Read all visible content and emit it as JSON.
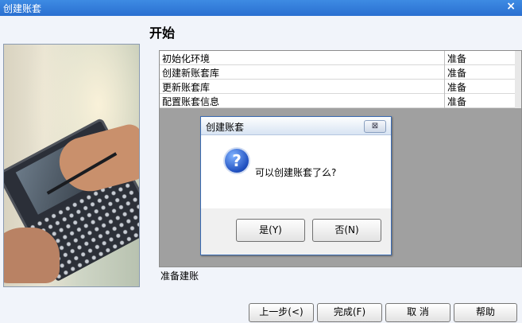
{
  "window": {
    "title": "创建账套",
    "close": "×"
  },
  "heading": "开始",
  "tasks": [
    {
      "name": "初始化环境",
      "status": "准备"
    },
    {
      "name": "创建新账套库",
      "status": "准备"
    },
    {
      "name": "更新账套库",
      "status": "准备"
    },
    {
      "name": "配置账套信息",
      "status": "准备"
    }
  ],
  "status_text": "准备建账",
  "dialog": {
    "title": "创建账套",
    "close": "⊠",
    "icon": "question-icon",
    "icon_glyph": "?",
    "message": "可以创建账套了么?",
    "yes": "是(Y)",
    "no": "否(N)"
  },
  "buttons": {
    "prev": "上一步(<)",
    "finish": "完成(F)",
    "cancel": "取 消",
    "help": "帮助"
  }
}
